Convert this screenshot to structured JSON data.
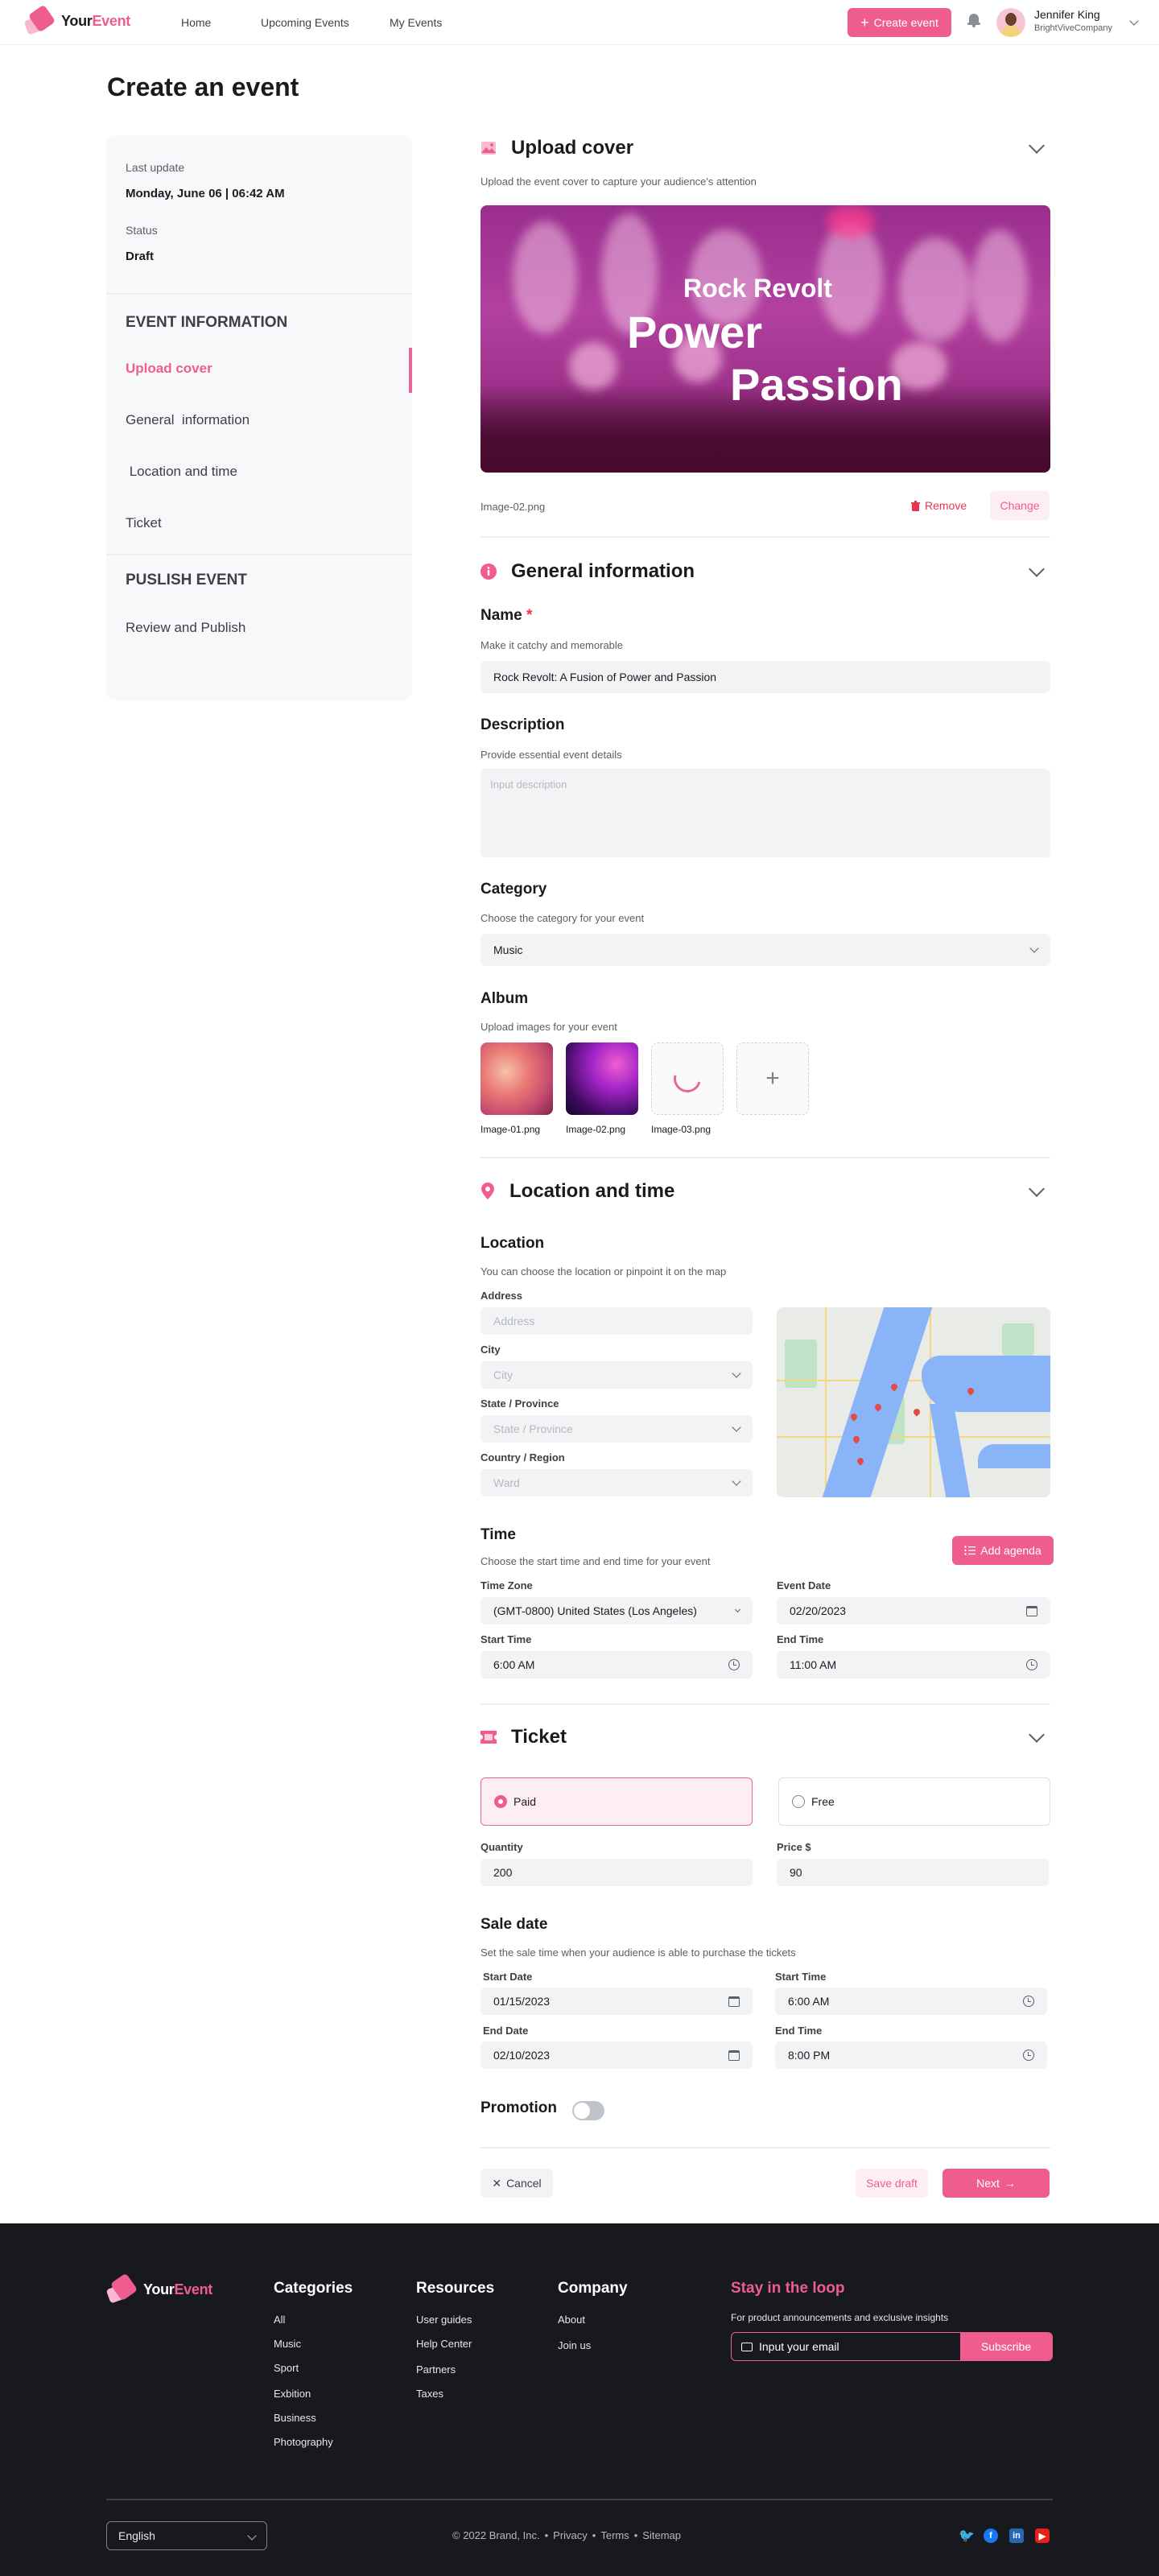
{
  "header": {
    "brand": {
      "part1": "Your",
      "part2": "Event"
    },
    "nav": [
      "Home",
      "Upcoming Events",
      "My Events"
    ],
    "create_button": "Create event",
    "user": {
      "name": "Jennifer King",
      "company": "BrightViveCompany"
    }
  },
  "page_title": "Create an event",
  "sidebar": {
    "last_update_label": "Last update",
    "last_update_value": "Monday, June 06 | 06:42 AM",
    "status_label": "Status",
    "status_value": "Draft",
    "section1": "EVENT INFORMATION",
    "items1": [
      "Upload cover",
      "General  information",
      " Location and time",
      "Ticket"
    ],
    "active_item": "Upload cover",
    "section2": "PUSLISH EVENT",
    "items2": [
      "Review and Publish"
    ]
  },
  "upload_cover": {
    "title": "Upload cover",
    "subtitle": "Upload the event cover to capture your audience's attention",
    "cover_text": {
      "line1": "Rock Revolt",
      "line2": "Power",
      "line3": "Passion"
    },
    "filename": "Image-02.png",
    "remove_label": "Remove",
    "change_label": "Change"
  },
  "general": {
    "title": "General information",
    "name_label": "Name",
    "name_required": "*",
    "name_hint": "Make it catchy and memorable",
    "name_value": "Rock Revolt: A Fusion of Power and Passion",
    "desc_label": "Description",
    "desc_hint": "Provide essential event details",
    "desc_placeholder": "Input description",
    "category_label": "Category",
    "category_hint": "Choose the category for your event",
    "category_value": "Music",
    "album_label": "Album",
    "album_hint": "Upload images for your event",
    "album": [
      "Image-01.png",
      "Image-02.png",
      "Image-03.png"
    ],
    "album_add": "+"
  },
  "location": {
    "title": "Location and time",
    "loc_label": "Location",
    "loc_hint": "You can choose the location or pinpoint it on the map",
    "address_label": "Address",
    "address_placeholder": "Address",
    "city_label": "City",
    "city_placeholder": "City",
    "state_label": "State / Province",
    "state_placeholder": "State / Province",
    "country_label": "Country / Region",
    "country_placeholder": "Ward",
    "time_label": "Time",
    "time_hint": "Choose the start time and end time for your event",
    "add_agenda": "Add agenda",
    "tz_label": "Time Zone",
    "tz_value": "(GMT-0800) United States (Los Angeles)",
    "event_date_label": "Event Date",
    "event_date_value": "02/20/2023",
    "start_time_label": "Start Time",
    "start_time_value": "6:00 AM",
    "end_time_label": "End Time",
    "end_time_value": "11:00 AM"
  },
  "ticket": {
    "title": "Ticket",
    "paid_label": "Paid",
    "free_label": "Free",
    "selected": "Paid",
    "qty_label": "Quantity",
    "qty_value": "200",
    "price_label": "Price $",
    "price_value": "90",
    "sale_label": "Sale date",
    "sale_hint": "Set the sale time when your audience is able to purchase the tickets",
    "sd_label": "Start Date",
    "sd_value": "01/15/2023",
    "st_label": "Start Time",
    "st_value": "6:00 AM",
    "ed_label": "End Date",
    "ed_value": "02/10/2023",
    "et_label": "End Time",
    "et_value": "8:00 PM",
    "promotion_label": "Promotion",
    "promotion_on": false
  },
  "actions": {
    "cancel": "Cancel",
    "save_draft": "Save draft",
    "next": "Next"
  },
  "footer": {
    "categories_title": "Categories",
    "categories": [
      "All",
      "Music",
      "Sport",
      "Exbition",
      "Business",
      "Photography"
    ],
    "resources_title": "Resources",
    "resources": [
      "User guides",
      "Help Center",
      "Partners",
      "Taxes"
    ],
    "company_title": "Company",
    "company": [
      "About",
      "Join us"
    ],
    "loop_title": "Stay in the loop",
    "loop_hint": "For product announcements and exclusive insights",
    "email_placeholder": "Input your email",
    "subscribe": "Subscribe",
    "language": "English",
    "copyright": "© 2022 Brand, Inc.",
    "links": [
      "Privacy",
      "Terms",
      "Sitemap"
    ],
    "social": [
      "twitter",
      "facebook",
      "linkedin",
      "youtube"
    ]
  },
  "colors": {
    "accent": "#ef5d8f",
    "footer_bg": "#18191e",
    "sidebar_bg": "#f7f8fa"
  }
}
